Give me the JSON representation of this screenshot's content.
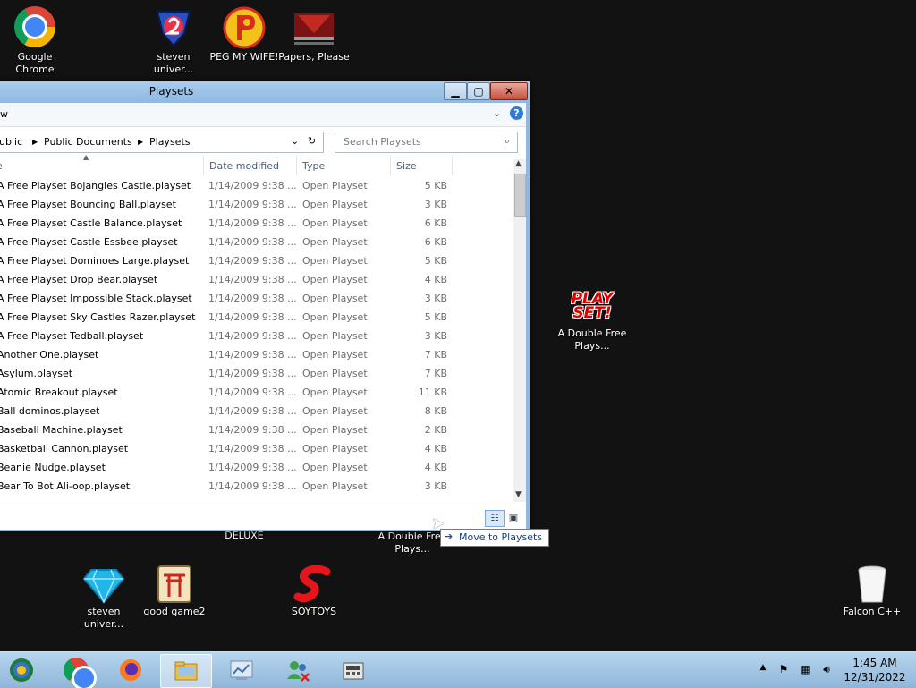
{
  "desktop": {
    "icons": [
      {
        "label": "Google Chrome"
      },
      {
        "label": "steven univer..."
      },
      {
        "label": "PEG MY WIFE!"
      },
      {
        "label": "Papers, Please"
      },
      {
        "label": "A Double Free Plays..."
      },
      {
        "label": "DELUXE"
      },
      {
        "label": "A Double Free Plays..."
      },
      {
        "label": "steven univer..."
      },
      {
        "label": "good game2"
      },
      {
        "label": "SOYTOYS"
      },
      {
        "label": "Falcon C++"
      }
    ],
    "playset_logo_top": "PLAY",
    "playset_logo_bottom": "SET!"
  },
  "window": {
    "title": "Playsets",
    "menu_partial": "w",
    "breadcrumb": [
      "ublic",
      "Public Documents",
      "Playsets"
    ],
    "search_placeholder": "Search Playsets",
    "columns": {
      "name": "e",
      "date": "Date modified",
      "type": "Type",
      "size": "Size"
    },
    "files": [
      {
        "name": "A Free Playset Bojangles Castle.playset",
        "date": "1/14/2009 9:38 ...",
        "type": "Open Playset",
        "size": "5 KB"
      },
      {
        "name": "A Free Playset Bouncing Ball.playset",
        "date": "1/14/2009 9:38 ...",
        "type": "Open Playset",
        "size": "3 KB"
      },
      {
        "name": "A Free Playset Castle Balance.playset",
        "date": "1/14/2009 9:38 ...",
        "type": "Open Playset",
        "size": "6 KB"
      },
      {
        "name": "A Free Playset Castle Essbee.playset",
        "date": "1/14/2009 9:38 ...",
        "type": "Open Playset",
        "size": "6 KB"
      },
      {
        "name": "A Free Playset Dominoes Large.playset",
        "date": "1/14/2009 9:38 ...",
        "type": "Open Playset",
        "size": "5 KB"
      },
      {
        "name": "A Free Playset Drop Bear.playset",
        "date": "1/14/2009 9:38 ...",
        "type": "Open Playset",
        "size": "4 KB"
      },
      {
        "name": "A Free Playset Impossible Stack.playset",
        "date": "1/14/2009 9:38 ...",
        "type": "Open Playset",
        "size": "3 KB"
      },
      {
        "name": "A Free Playset Sky Castles Razer.playset",
        "date": "1/14/2009 9:38 ...",
        "type": "Open Playset",
        "size": "5 KB"
      },
      {
        "name": "A Free Playset Tedball.playset",
        "date": "1/14/2009 9:38 ...",
        "type": "Open Playset",
        "size": "3 KB"
      },
      {
        "name": "Another One.playset",
        "date": "1/14/2009 9:38 ...",
        "type": "Open Playset",
        "size": "7 KB"
      },
      {
        "name": "Asylum.playset",
        "date": "1/14/2009 9:38 ...",
        "type": "Open Playset",
        "size": "7 KB"
      },
      {
        "name": "Atomic Breakout.playset",
        "date": "1/14/2009 9:38 ...",
        "type": "Open Playset",
        "size": "11 KB"
      },
      {
        "name": "Ball dominos.playset",
        "date": "1/14/2009 9:38 ...",
        "type": "Open Playset",
        "size": "8 KB"
      },
      {
        "name": "Baseball Machine.playset",
        "date": "1/14/2009 9:38 ...",
        "type": "Open Playset",
        "size": "2 KB"
      },
      {
        "name": "Basketball Cannon.playset",
        "date": "1/14/2009 9:38 ...",
        "type": "Open Playset",
        "size": "4 KB"
      },
      {
        "name": "Beanie Nudge.playset",
        "date": "1/14/2009 9:38 ...",
        "type": "Open Playset",
        "size": "4 KB"
      },
      {
        "name": "Bear To Bot Ali-oop.playset",
        "date": "1/14/2009 9:38 ...",
        "type": "Open Playset",
        "size": "3 KB"
      }
    ]
  },
  "tooltip": {
    "text": "Move to Playsets"
  },
  "taskbar": {
    "time": "1:45 AM",
    "date": "12/31/2022"
  },
  "colors": {
    "taskbar": "#8fb6da",
    "window_frame": "#8fb8e0",
    "close": "#c7503c",
    "desktop": "#121212"
  }
}
